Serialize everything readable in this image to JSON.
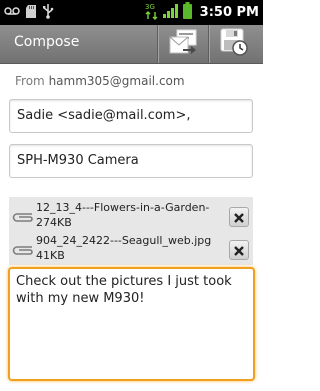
{
  "status_bar": {
    "time": "3:50 PM",
    "network_badge": "3G",
    "icons": [
      "voicemail-icon",
      "sd-card-icon",
      "usb-icon",
      "data-activity-icon",
      "signal-icon",
      "battery-icon"
    ]
  },
  "title_bar": {
    "title": "Compose",
    "actions": [
      "send-icon",
      "save-draft-icon"
    ]
  },
  "from": {
    "label": "From",
    "address": "hamm305@gmail.com"
  },
  "to": {
    "value": "Sadie <sadie@mail.com>,"
  },
  "subject": {
    "value": "SPH-M930 Camera"
  },
  "attachments": [
    {
      "name": "12_13_4---Flowers-in-a-Garden-",
      "size": "274KB"
    },
    {
      "name": "904_24_2422---Seagull_web.jpg",
      "size": "41KB"
    }
  ],
  "body": {
    "text": "Check out the pictures I just took with my new M930!"
  },
  "colors": {
    "focus_border": "#f0a020",
    "titlebar": "#7f7f7f",
    "status_bar": "#000000",
    "battery": "#5ab82b"
  }
}
